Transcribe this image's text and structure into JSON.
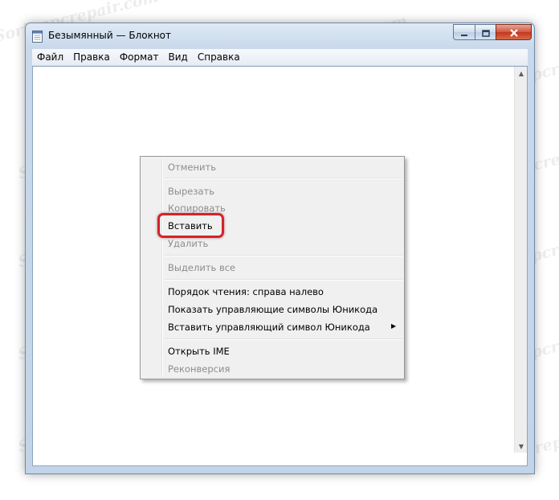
{
  "window": {
    "title": "Безымянный — Блокнот",
    "icon": "notepad-icon"
  },
  "caption_buttons": {
    "minimize_icon": "minimize-icon",
    "maximize_icon": "maximize-icon",
    "close_icon": "close-icon"
  },
  "menubar": {
    "items": [
      "Файл",
      "Правка",
      "Формат",
      "Вид",
      "Справка"
    ]
  },
  "context_menu": {
    "items": [
      {
        "label": "Отменить",
        "enabled": false
      },
      {
        "label": "Вырезать",
        "enabled": false
      },
      {
        "label": "Копировать",
        "enabled": false
      },
      {
        "label": "Вставить",
        "enabled": true
      },
      {
        "label": "Удалить",
        "enabled": false
      },
      {
        "label": "Выделить все",
        "enabled": false
      },
      {
        "label": "Порядок чтения: справа налево",
        "enabled": true
      },
      {
        "label": "Показать управляющие символы Юникода",
        "enabled": true
      },
      {
        "label": "Вставить управляющий символ Юникода",
        "enabled": true,
        "submenu": true
      },
      {
        "label": "Открыть IME",
        "enabled": true
      },
      {
        "label": "Реконверсия",
        "enabled": false
      }
    ]
  },
  "highlight": {
    "color": "#d3232a",
    "target": "Вставить"
  },
  "watermark": {
    "text": "Soringpcrepair.com"
  }
}
